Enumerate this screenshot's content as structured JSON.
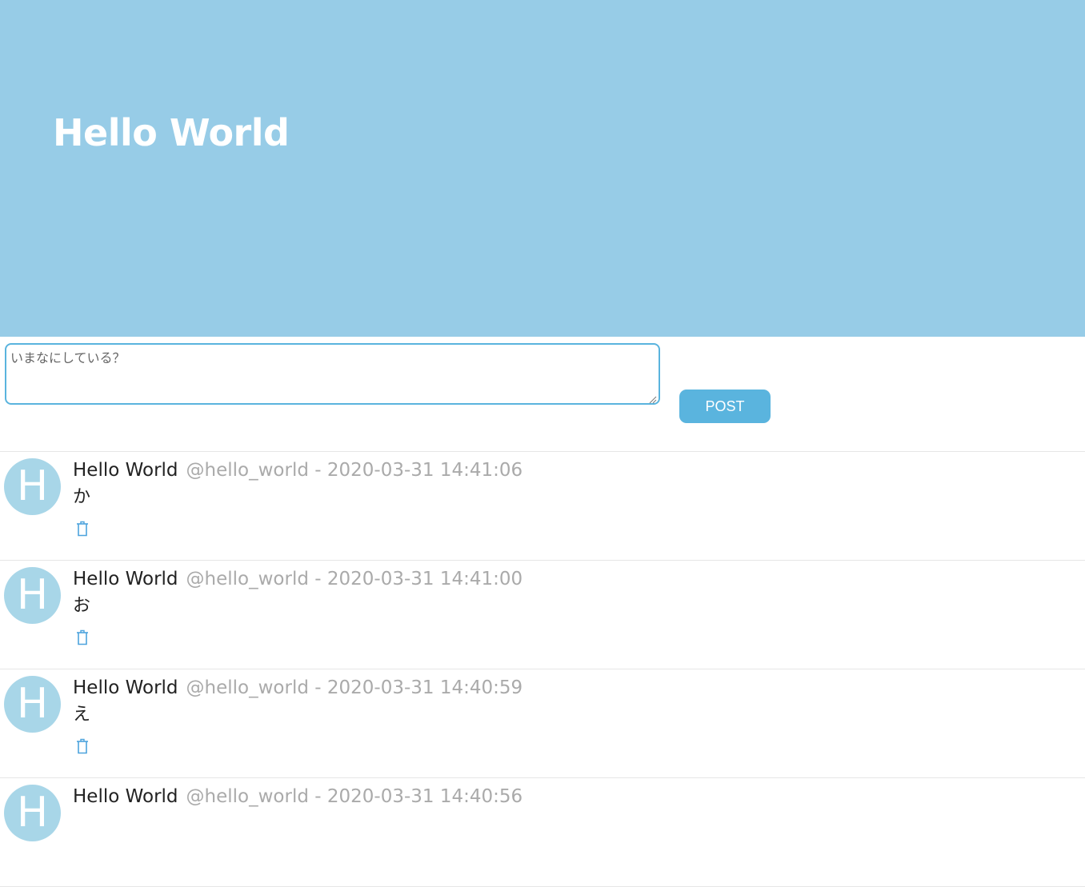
{
  "header": {
    "title": "Hello World",
    "background": "#97cce7"
  },
  "compose": {
    "placeholder": "いまなにしている？",
    "post_label": "POST",
    "accent": "#5ab4de"
  },
  "posts": [
    {
      "avatar_letter": "H",
      "display_name": "Hello World",
      "meta": "@hello_world - 2020-03-31 14:41:06",
      "body": "か",
      "action_icon": "trash-icon"
    },
    {
      "avatar_letter": "H",
      "display_name": "Hello World",
      "meta": "@hello_world - 2020-03-31 14:41:00",
      "body": "お",
      "action_icon": "trash-icon"
    },
    {
      "avatar_letter": "H",
      "display_name": "Hello World",
      "meta": "@hello_world - 2020-03-31 14:40:59",
      "body": "え",
      "action_icon": "trash-icon"
    },
    {
      "avatar_letter": "H",
      "display_name": "Hello World",
      "meta": "@hello_world - 2020-03-31 14:40:56",
      "body": "",
      "action_icon": "trash-icon"
    }
  ]
}
